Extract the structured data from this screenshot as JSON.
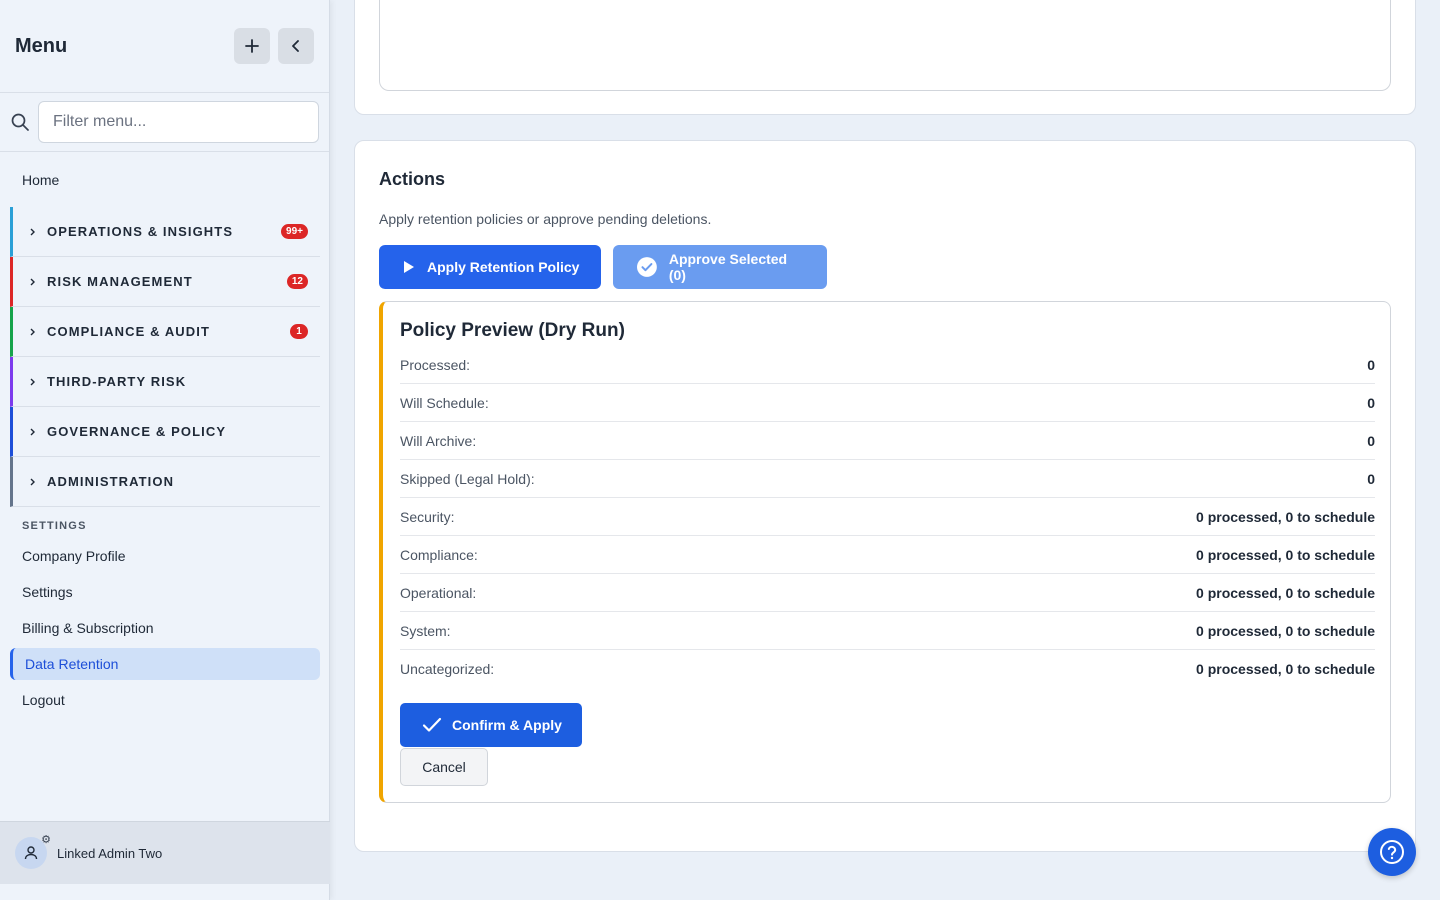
{
  "sidebar": {
    "title": "Menu",
    "search": {
      "placeholder": "Filter menu..."
    },
    "home": "Home",
    "groups": [
      {
        "label": "OPERATIONS & INSIGHTS",
        "badge": "99+",
        "color": "#2a9fd6"
      },
      {
        "label": "RISK MANAGEMENT",
        "badge": "12",
        "color": "#dc2626"
      },
      {
        "label": "COMPLIANCE & AUDIT",
        "badge": "1",
        "color": "#16a34a"
      },
      {
        "label": "THIRD-PARTY RISK",
        "badge": "",
        "color": "#7c3aed"
      },
      {
        "label": "GOVERNANCE & POLICY",
        "badge": "",
        "color": "#1d4ed8"
      },
      {
        "label": "ADMINISTRATION",
        "badge": "",
        "color": "#64748b"
      }
    ],
    "settings_label": "SETTINGS",
    "items": [
      "Company Profile",
      "Settings",
      "Billing & Subscription",
      "Data Retention",
      "Logout"
    ],
    "active_item": "Data Retention",
    "user": {
      "name": "Linked Admin Two"
    }
  },
  "actions": {
    "title": "Actions",
    "description": "Apply retention policies or approve pending deletions.",
    "apply_label": "Apply Retention Policy",
    "approve_label": "Approve Selected (0)"
  },
  "preview": {
    "title": "Policy Preview (Dry Run)",
    "rows": [
      {
        "label": "Processed:",
        "value": "0"
      },
      {
        "label": "Will Schedule:",
        "value": "0"
      },
      {
        "label": "Will Archive:",
        "value": "0"
      },
      {
        "label": "Skipped (Legal Hold):",
        "value": "0"
      },
      {
        "label": "Security:",
        "value": "0 processed, 0 to schedule"
      },
      {
        "label": "Compliance:",
        "value": "0 processed, 0 to schedule"
      },
      {
        "label": "Operational:",
        "value": "0 processed, 0 to schedule"
      },
      {
        "label": "System:",
        "value": "0 processed, 0 to schedule"
      },
      {
        "label": "Uncategorized:",
        "value": "0 processed, 0 to schedule"
      }
    ],
    "confirm_label": "Confirm & Apply",
    "cancel_label": "Cancel"
  },
  "colors": {
    "primary": "#2563eb",
    "accent_border": "#f0a500",
    "badge": "#dc2626"
  }
}
